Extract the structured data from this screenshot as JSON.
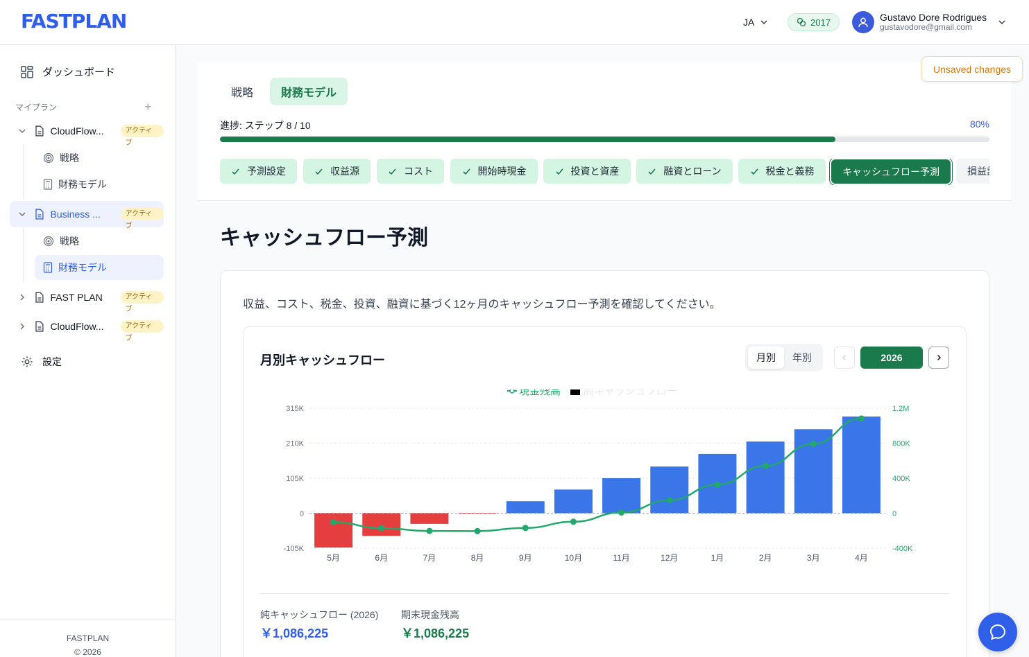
{
  "header": {
    "logo": "FASTPLAN",
    "language": "JA",
    "credits": "2017",
    "user_name": "Gustavo Dore Rodrigues",
    "user_email": "gustavodore@gmail.com"
  },
  "sidebar": {
    "dashboard": "ダッシュボード",
    "section": "マイプラン",
    "plans": [
      {
        "name": "CloudFlow...",
        "badge": "アクティブ"
      },
      {
        "name": "Business ...",
        "badge": "アクティブ"
      },
      {
        "name": "FAST PLAN",
        "badge": "アクティブ"
      },
      {
        "name": "CloudFlow...",
        "badge": "アクティブ"
      }
    ],
    "sub_strategy": "戦略",
    "sub_financial": "財務モデル",
    "settings": "設定",
    "footer_brand": "FASTPLAN",
    "footer_copy": "© 2026"
  },
  "main": {
    "tabs": [
      "戦略",
      "財務モデル"
    ],
    "unsaved": "Unsaved changes",
    "progress_label": "進捗: ステップ 8 / 10",
    "progress_pct": "80%",
    "progress_value": 0.8,
    "steps": [
      "予測設定",
      "収益源",
      "コスト",
      "開始時現金",
      "投資と資産",
      "融資とローン",
      "税金と義務",
      "キャッシュフロー予測",
      "損益計"
    ],
    "page_title": "キャッシュフロー予測",
    "description": "収益、コスト、税金、投資、融資に基づく12ヶ月のキャッシュフロー予測を確認してください。",
    "chart_title": "月別キャッシュフロー",
    "toggle_monthly": "月別",
    "toggle_yearly": "年別",
    "year": "2026",
    "summary": [
      {
        "label": "純キャッシュフロー (2026)",
        "value": "￥1,086,225"
      },
      {
        "label": "期末現金残高",
        "value": "￥1,086,225"
      }
    ]
  },
  "colors": {
    "brand": "#2f5fe8",
    "green": "#1a7a4c",
    "line": "#22a86b",
    "bar_pos": "#3b76e8",
    "bar_neg": "#e53e3e"
  },
  "chart_data": {
    "type": "bar",
    "categories": [
      "5月",
      "6月",
      "7月",
      "8月",
      "9月",
      "10月",
      "11月",
      "12月",
      "1月",
      "2月",
      "3月",
      "4月"
    ],
    "series": [
      {
        "name": "純キャッシュフロー",
        "axis": "left",
        "type": "bar",
        "values": [
          -103000,
          -68000,
          -32000,
          -1500,
          36000,
          71000,
          105000,
          140000,
          178000,
          215000,
          252000,
          290000
        ]
      },
      {
        "name": "現金残高",
        "axis": "right",
        "type": "line",
        "values": [
          -103000,
          -171000,
          -203000,
          -204500,
          -168500,
          -97500,
          7500,
          147500,
          325500,
          540500,
          792500,
          1082500
        ]
      }
    ],
    "left_ticks": [
      "315K",
      "210K",
      "105K",
      "0",
      "-105K"
    ],
    "right_ticks": [
      "1.2M",
      "800K",
      "400K",
      "0",
      "-400K"
    ],
    "left_range": [
      -105000,
      315000
    ],
    "right_range": [
      -400000,
      1200000
    ],
    "legend": "top-center"
  }
}
